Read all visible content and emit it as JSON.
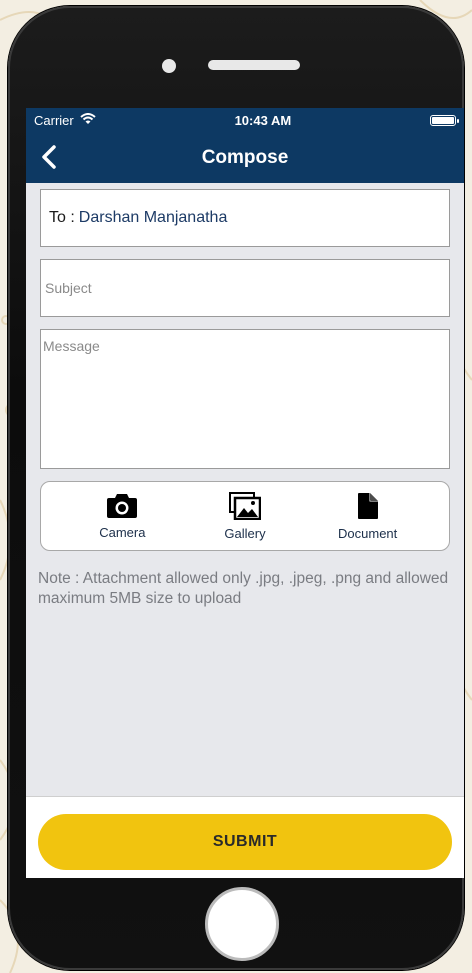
{
  "status_bar": {
    "carrier": "Carrier",
    "time": "10:43 AM"
  },
  "navbar": {
    "title": "Compose"
  },
  "compose": {
    "to_label": "To :",
    "to_value": "Darshan Manjanatha",
    "subject_placeholder": "Subject",
    "message_placeholder": "Message"
  },
  "attachments": {
    "items": [
      {
        "label": "Camera",
        "icon": "camera-icon"
      },
      {
        "label": "Gallery",
        "icon": "gallery-icon"
      },
      {
        "label": "Document",
        "icon": "document-icon"
      }
    ]
  },
  "note": "Note : Attachment allowed only .jpg, .jpeg, .png and allowed maximum 5MB size to upload",
  "submit_label": "SUBMIT",
  "colors": {
    "header": "#0d3963",
    "accent": "#f1c40f",
    "background": "#e7e8ec"
  }
}
